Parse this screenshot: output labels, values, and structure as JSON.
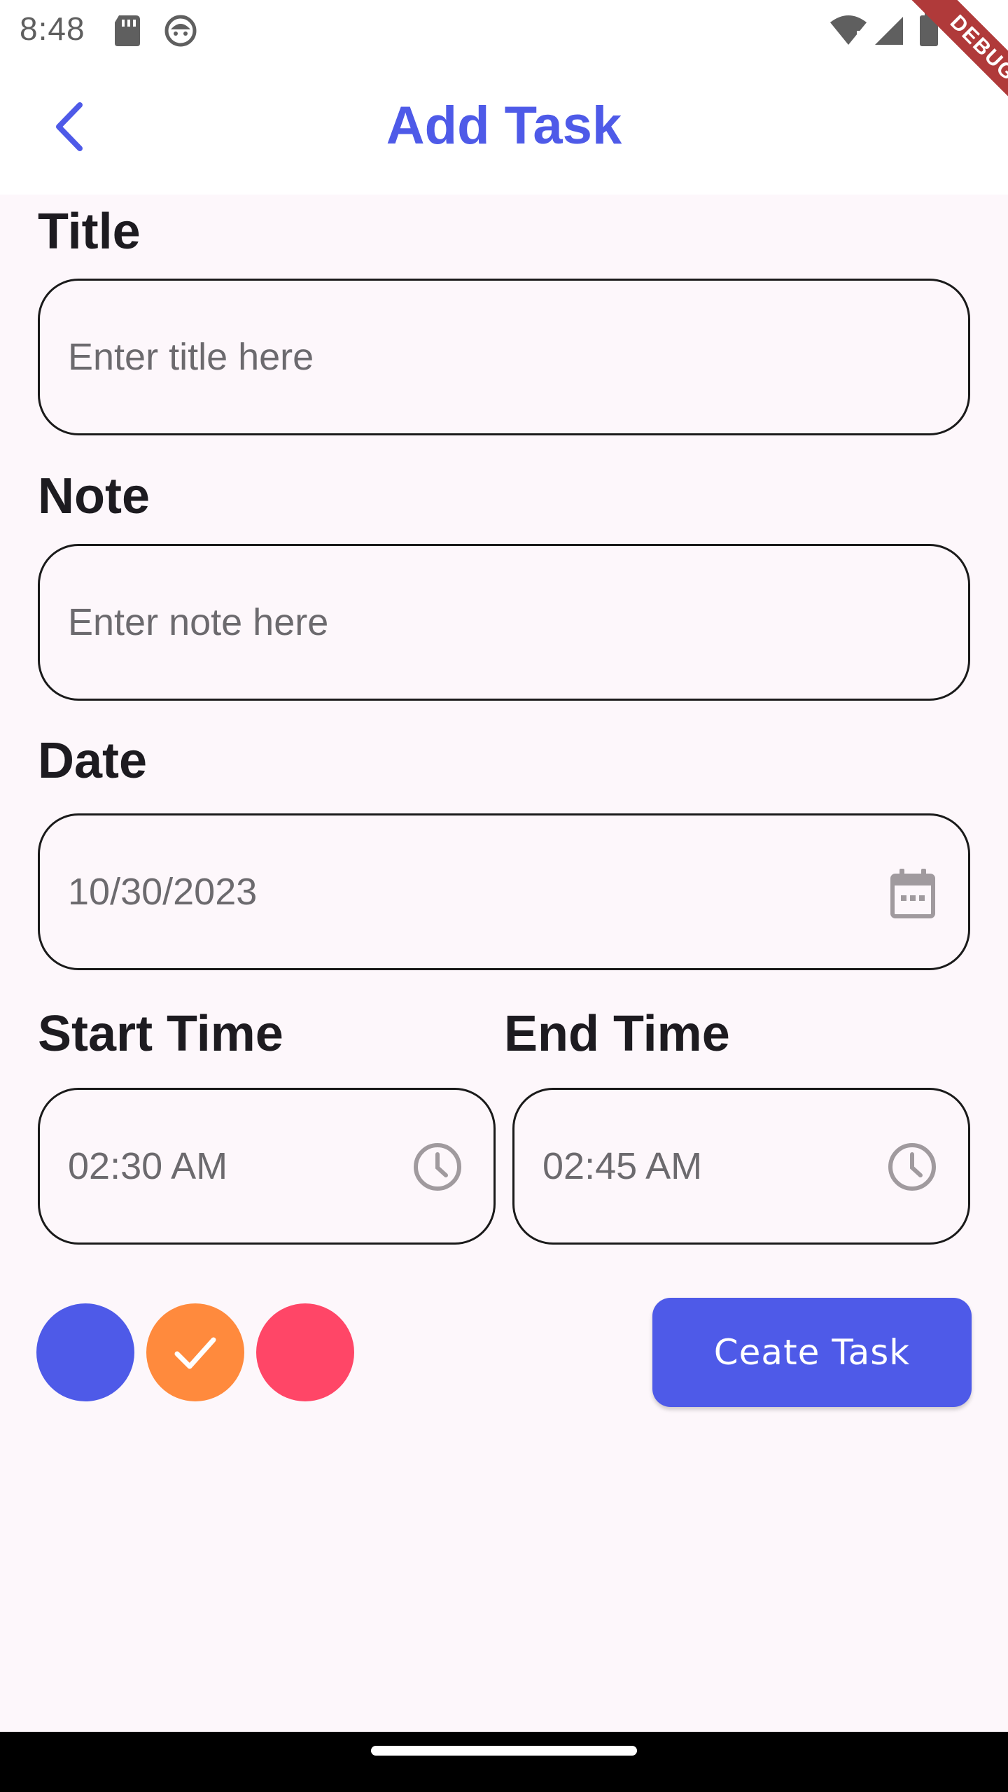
{
  "status_bar": {
    "time": "8:48"
  },
  "debug_banner": "DEBUG",
  "app_bar": {
    "title": "Add Task",
    "back_icon": "chevron-left-icon"
  },
  "form": {
    "title": {
      "label": "Title",
      "placeholder": "Enter title here"
    },
    "note": {
      "label": "Note",
      "placeholder": "Enter note here"
    },
    "date": {
      "label": "Date",
      "value": "10/30/2023",
      "icon": "calendar-icon"
    },
    "start_time": {
      "label": "Start Time",
      "value": "02:30 AM",
      "icon": "clock-icon"
    },
    "end_time": {
      "label": "End Time",
      "value": "02:45 AM",
      "icon": "clock-icon"
    }
  },
  "colors": {
    "options": [
      "#4e5ae8",
      "#ff8a3d",
      "#ff4667"
    ],
    "selected_index": 1
  },
  "create_button": {
    "label": "Ceate Task"
  },
  "theme": {
    "accent": "#4e5ae8",
    "background": "#fdf7fb"
  }
}
